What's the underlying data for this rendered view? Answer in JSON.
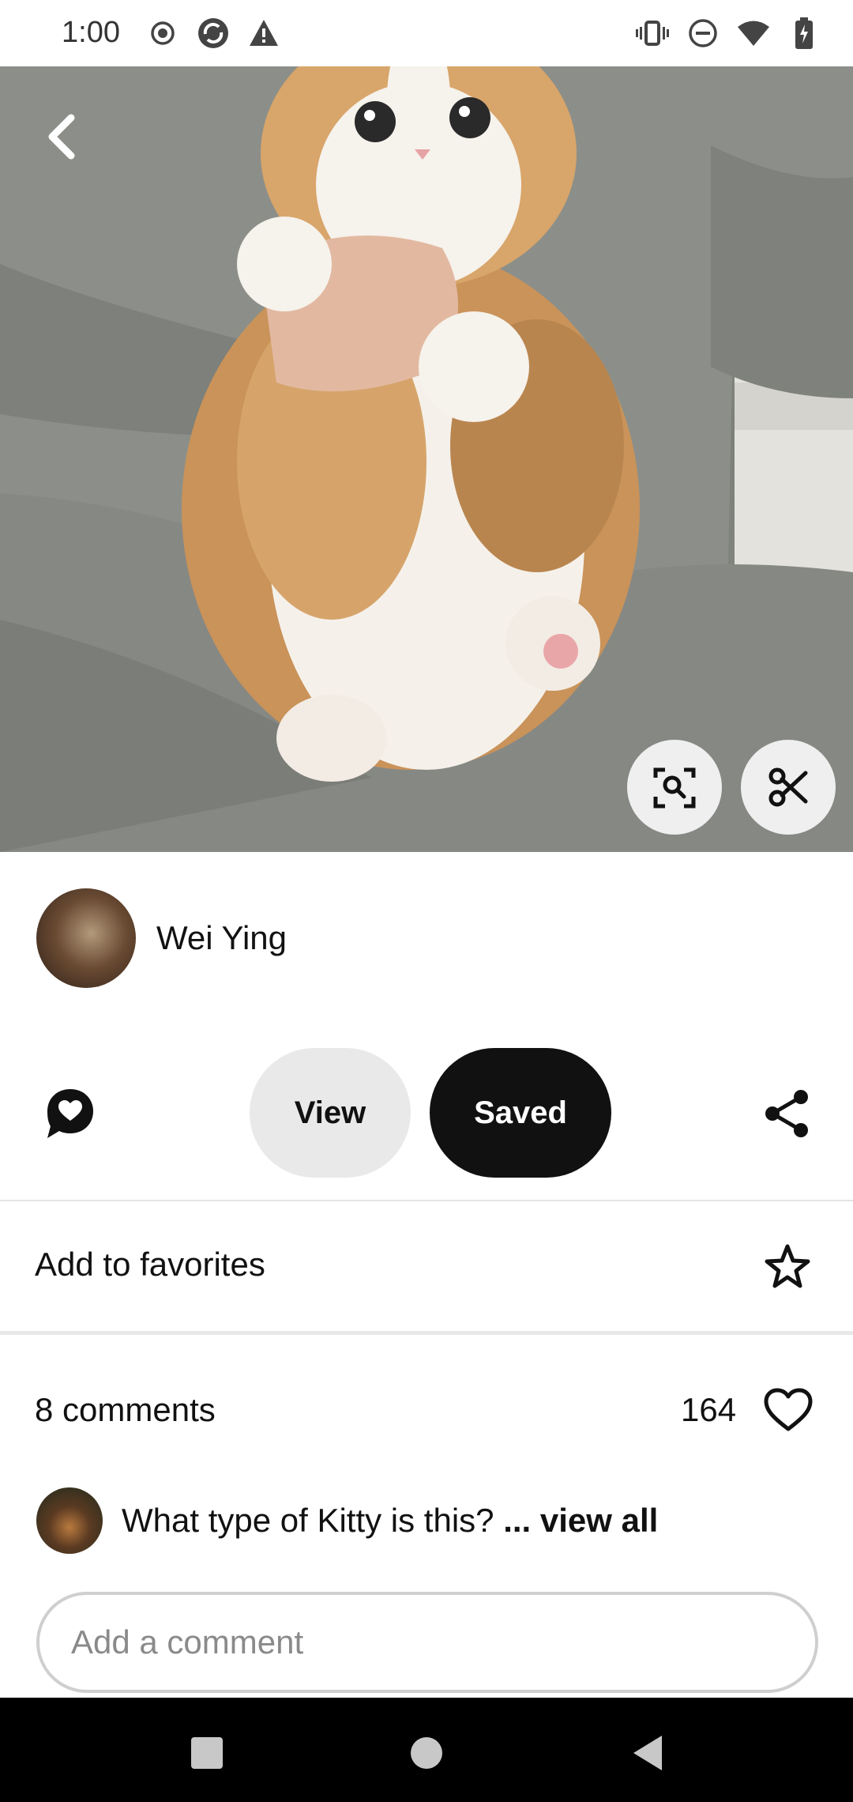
{
  "status_bar": {
    "time": "1:00",
    "left_icons": [
      "record-icon",
      "sync-icon",
      "warning-icon"
    ],
    "right_icons": [
      "vibrate-icon",
      "dnd-icon",
      "wifi-icon",
      "battery-icon"
    ]
  },
  "pin": {
    "image_subject": "fluffy orange and white kitten held on lap"
  },
  "author": {
    "name": "Wei Ying"
  },
  "actions": {
    "view_label": "View",
    "saved_label": "Saved"
  },
  "favorites": {
    "label": "Add to favorites"
  },
  "comments": {
    "count_label": "8 comments",
    "like_count": "164",
    "preview_text": "What type of Kitty is this?",
    "view_all": "... view all",
    "input_placeholder": "Add a comment"
  },
  "colors": {
    "primary_button": "#111111",
    "secondary_button": "#e9e9e9",
    "background": "#ffffff"
  }
}
